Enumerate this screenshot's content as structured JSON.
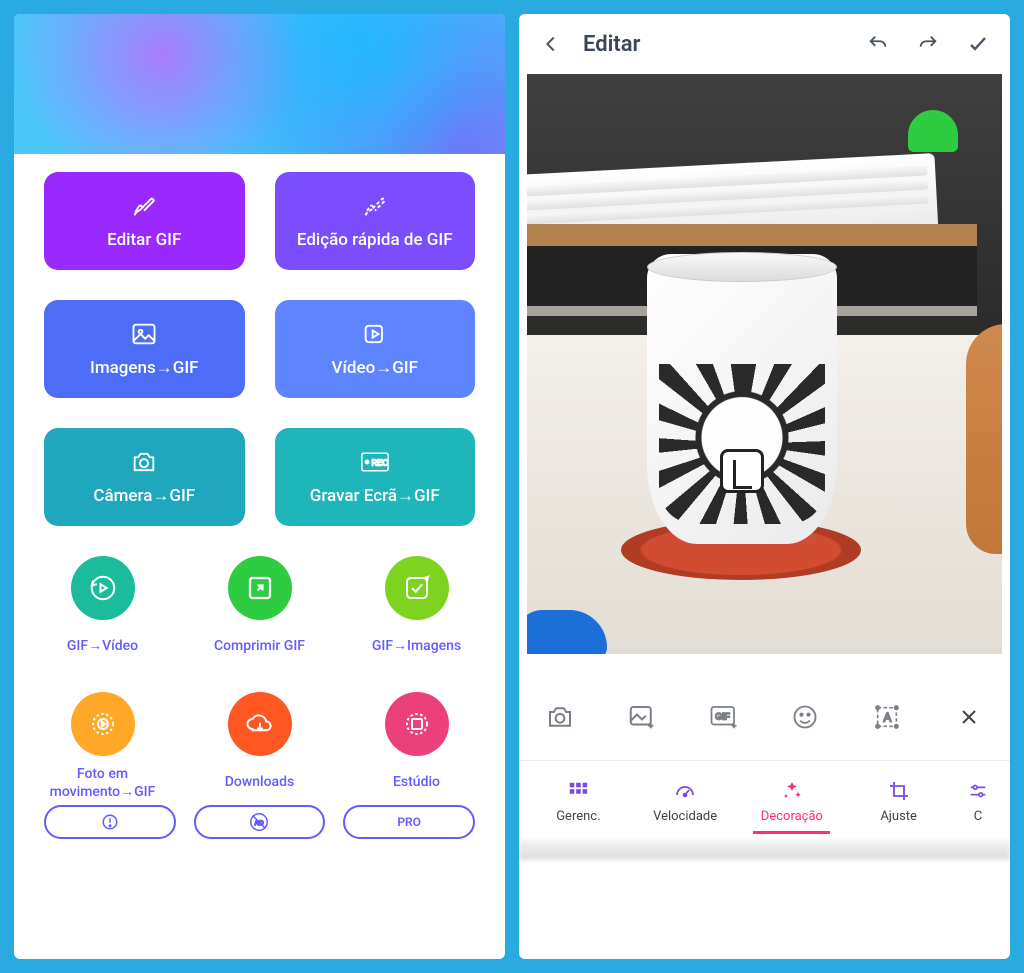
{
  "left": {
    "tiles": {
      "edit": "Editar GIF",
      "quick": "Edição rápida de GIF",
      "images": "Imagens→GIF",
      "video": "Vídeo→GIF",
      "camera": "Câmera→GIF",
      "record": "Gravar Ecrã→GIF"
    },
    "circles": {
      "gif2video": "GIF→Vídeo",
      "compress": "Comprimir GIF",
      "gif2img": "GIF→Imagens",
      "livephoto": "Foto em\nmovimento→GIF",
      "downloads": "Downloads",
      "studio": "Estúdio"
    },
    "pills": {
      "info": "!",
      "noad": "AD",
      "pro": "PRO"
    }
  },
  "right": {
    "header": {
      "title": "Editar"
    },
    "tabs": {
      "manage": "Gerenc.",
      "speed": "Velocidade",
      "decorate": "Decoração",
      "adjust": "Ajuste",
      "more": "C"
    }
  }
}
